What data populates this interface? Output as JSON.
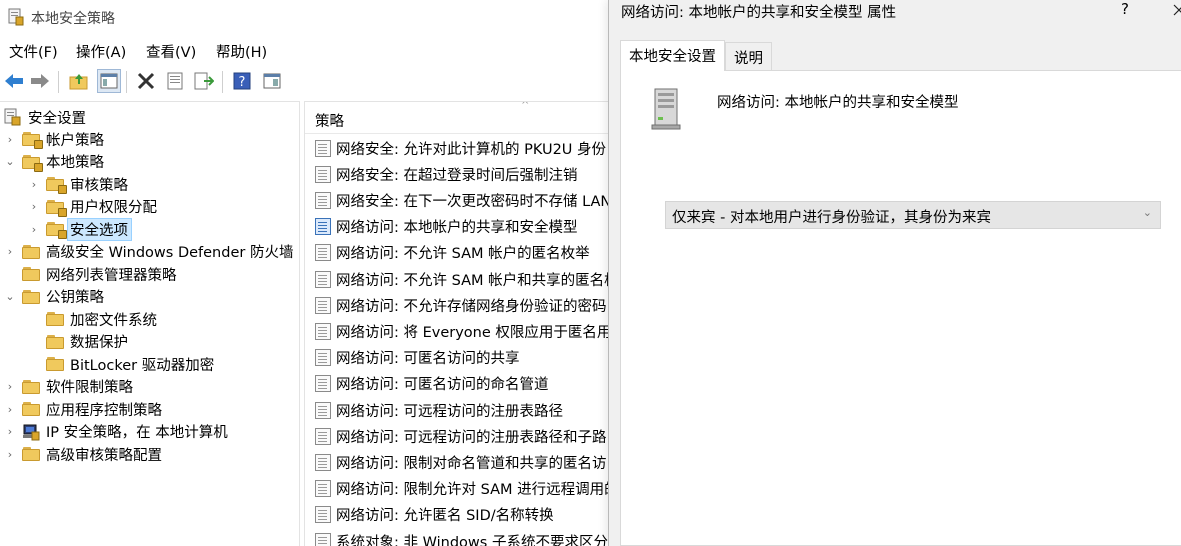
{
  "main_window": {
    "title": "本地安全策略",
    "menu": [
      "文件(F)",
      "操作(A)",
      "查看(V)",
      "帮助(H)"
    ],
    "toolbar_icons": [
      "back-icon",
      "forward-icon",
      "up-folder-icon",
      "show-hide-tree-icon",
      "delete-icon",
      "properties-icon",
      "export-list-icon",
      "help-icon",
      "console-view-icon"
    ]
  },
  "tree": {
    "root": "安全设置",
    "items": [
      {
        "label": "帐户策略",
        "indent": 1,
        "chevron": ">",
        "lock": true
      },
      {
        "label": "本地策略",
        "indent": 1,
        "chevron": "v",
        "lock": true
      },
      {
        "label": "审核策略",
        "indent": 2,
        "chevron": ">",
        "lock": true
      },
      {
        "label": "用户权限分配",
        "indent": 2,
        "chevron": ">",
        "lock": true
      },
      {
        "label": "安全选项",
        "indent": 2,
        "chevron": ">",
        "lock": true,
        "selected": true
      },
      {
        "label": "高级安全 Windows Defender 防火墙",
        "indent": 1,
        "chevron": ">",
        "lock": false
      },
      {
        "label": "网络列表管理器策略",
        "indent": 1,
        "chevron": "",
        "lock": false
      },
      {
        "label": "公钥策略",
        "indent": 1,
        "chevron": "v",
        "lock": false
      },
      {
        "label": "加密文件系统",
        "indent": 2,
        "chevron": "",
        "lock": false
      },
      {
        "label": "数据保护",
        "indent": 2,
        "chevron": "",
        "lock": false
      },
      {
        "label": "BitLocker 驱动器加密",
        "indent": 2,
        "chevron": "",
        "lock": false
      },
      {
        "label": "软件限制策略",
        "indent": 1,
        "chevron": ">",
        "lock": false
      },
      {
        "label": "应用程序控制策略",
        "indent": 1,
        "chevron": ">",
        "lock": false
      },
      {
        "label": "IP 安全策略，在 本地计算机",
        "indent": 1,
        "chevron": ">",
        "lock": false,
        "ip": true
      },
      {
        "label": "高级审核策略配置",
        "indent": 1,
        "chevron": ">",
        "lock": false
      }
    ]
  },
  "list": {
    "column_header": "策略",
    "sort_indicator": "^",
    "rows": [
      "网络安全: 允许对此计算机的 PKU2U 身份",
      "网络安全: 在超过登录时间后强制注销",
      "网络安全: 在下一次更改密码时不存储 LAN",
      "网络访问: 本地帐户的共享和安全模型",
      "网络访问: 不允许 SAM 帐户的匿名枚举",
      "网络访问: 不允许 SAM 帐户和共享的匿名枚",
      "网络访问: 不允许存储网络身份验证的密码",
      "网络访问: 将 Everyone 权限应用于匿名用户",
      "网络访问: 可匿名访问的共享",
      "网络访问: 可匿名访问的命名管道",
      "网络访问: 可远程访问的注册表路径",
      "网络访问: 可远程访问的注册表路径和子路",
      "网络访问: 限制对命名管道和共享的匿名访",
      "网络访问: 限制允许对 SAM 进行远程调用的",
      "网络访问: 允许匿名 SID/名称转换",
      "系统对象: 非 Windows 子系统不要求区分"
    ],
    "active_index": 3
  },
  "dialog": {
    "title": "网络访问: 本地帐户的共享和安全模型 属性",
    "help": "?",
    "close": "X",
    "tabs": [
      "本地安全设置",
      "说明"
    ],
    "policy_name": "网络访问: 本地帐户的共享和安全模型",
    "dropdown_value": "仅来宾 - 对本地用户进行身份验证，其身份为来宾",
    "dropdown_arrow": "⌄"
  }
}
